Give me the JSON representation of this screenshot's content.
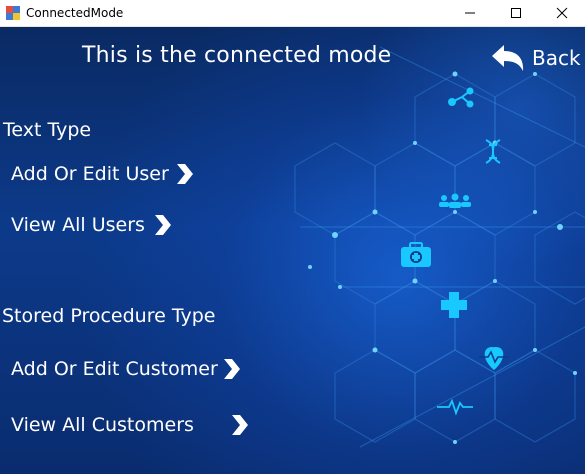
{
  "window": {
    "title": "ConnectedMode",
    "controls": [
      "minimize-icon",
      "maximize-icon",
      "close-icon"
    ]
  },
  "header": {
    "title": "This is the connected mode",
    "back_label": "Back",
    "back_icon": "curved-arrow-left-icon"
  },
  "sections": {
    "text_type": {
      "label": "Text Type",
      "links": [
        {
          "label": "Add Or Edit User",
          "icon": "chevron-right-icon"
        },
        {
          "label": "View All Users",
          "icon": "chevron-right-icon"
        }
      ]
    },
    "stored_procedure_type": {
      "label": "Stored Procedure Type",
      "links": [
        {
          "label": "Add Or Edit Customer",
          "icon": "chevron-right-icon"
        },
        {
          "label": "View All Customers",
          "icon": "chevron-right-icon"
        }
      ]
    }
  },
  "background_icons": [
    "molecule-icon",
    "dna-icon",
    "people-icon",
    "medical-kit-icon",
    "cross-icon",
    "heart-pulse-icon",
    "heartbeat-line-icon"
  ],
  "colors": {
    "background": "#0b2a66",
    "accent_cyan": "#19c8ff",
    "text": "#ffffff"
  }
}
